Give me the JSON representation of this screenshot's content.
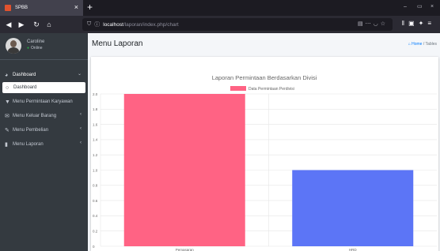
{
  "browser": {
    "tab_title": "SPBB",
    "tab_close": "×",
    "new_tab": "+",
    "url_host": "localhost",
    "url_path": "/laporan/index.php/chart",
    "window_controls": [
      "–",
      "▭",
      "×"
    ],
    "nav_icons": [
      "back-icon",
      "forward-icon",
      "reload-icon",
      "home-icon"
    ],
    "url_action_icons": [
      "reader-icon",
      "more-icon",
      "pocket-icon",
      "star-icon"
    ],
    "toolbar_icons": [
      "library-icon",
      "sidebar-icon",
      "extension-icon",
      "menu-icon"
    ]
  },
  "sidebar": {
    "user": {
      "name": "Caroline",
      "status": "Online"
    },
    "items": [
      {
        "label": "Dashboard",
        "icon": "palette-icon",
        "caret": "⌄"
      },
      {
        "label": "Dashboard",
        "icon": "circle-icon",
        "caret": ""
      },
      {
        "label": "Menu Permintaan Karyawan",
        "icon": "filter-icon",
        "caret": ""
      },
      {
        "label": "Menu Keluar Barang",
        "icon": "envelope-icon",
        "caret": "‹"
      },
      {
        "label": "Menu Pembelian",
        "icon": "pencil-icon",
        "caret": "‹"
      },
      {
        "label": "Menu Laporan",
        "icon": "file-icon",
        "caret": "‹"
      }
    ]
  },
  "content": {
    "page_title": "Menu Laporan",
    "breadcrumb": {
      "home": "Home",
      "current": "Tables"
    }
  },
  "chart_data": {
    "type": "bar",
    "title": "Laporan Permintaan Berdasarkan Divisi",
    "categories": [
      "Pemasaran",
      "HRD"
    ],
    "series": [
      {
        "name": "Data Permintaan Perdivisi",
        "values": [
          2,
          1
        ],
        "colors": [
          "#ff6384",
          "#5c75f6"
        ]
      }
    ],
    "ylim": [
      0,
      2
    ],
    "yticks": [
      "0",
      "0.2",
      "0.4",
      "0.6",
      "0.8",
      "1.0",
      "1.2",
      "1.4",
      "1.6",
      "1.8",
      "2.0"
    ],
    "legend": "top-center",
    "grid": true,
    "xlabel": "",
    "ylabel": ""
  }
}
